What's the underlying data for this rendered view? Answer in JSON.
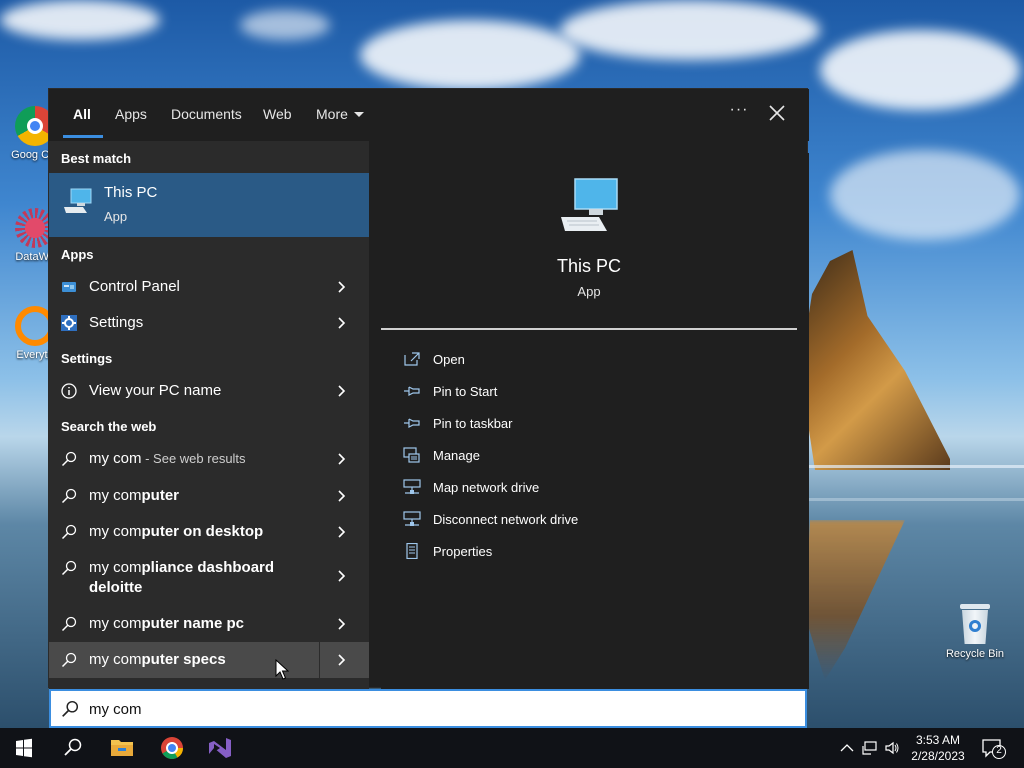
{
  "search_panel": {
    "tabs": [
      "All",
      "Apps",
      "Documents",
      "Web",
      "More"
    ],
    "options_label": "···",
    "best_match_header": "Best match",
    "best_match": {
      "title": "This PC",
      "subtitle": "App"
    },
    "apps_header": "Apps",
    "apps": [
      {
        "label": "Control Panel",
        "icon": "control-panel-icon"
      },
      {
        "label": "Settings",
        "icon": "gear-icon"
      }
    ],
    "settings_header": "Settings",
    "settings": [
      {
        "label": "View your PC name",
        "icon": "info-icon"
      }
    ],
    "web_header": "Search the web",
    "web_results": [
      {
        "prefix": "my com",
        "bold": "",
        "suffix": " - See web results"
      },
      {
        "prefix": "my com",
        "bold": "puter",
        "suffix": ""
      },
      {
        "prefix": "my com",
        "bold": "puter on desktop",
        "suffix": ""
      },
      {
        "prefix": "my com",
        "bold": "pliance dashboard",
        "line2": "deloitte",
        "suffix": ""
      },
      {
        "prefix": "my com",
        "bold": "puter name pc",
        "suffix": ""
      },
      {
        "prefix": "my com",
        "bold": "puter specs",
        "suffix": ""
      }
    ],
    "preview": {
      "title": "This PC",
      "subtitle": "App",
      "actions": [
        {
          "label": "Open",
          "icon": "open-icon"
        },
        {
          "label": "Pin to Start",
          "icon": "pin-icon"
        },
        {
          "label": "Pin to taskbar",
          "icon": "pin-icon"
        },
        {
          "label": "Manage",
          "icon": "manage-icon"
        },
        {
          "label": "Map network drive",
          "icon": "network-drive-icon"
        },
        {
          "label": "Disconnect network drive",
          "icon": "network-drive-icon"
        },
        {
          "label": "Properties",
          "icon": "properties-icon"
        }
      ]
    },
    "search_query": "my com"
  },
  "desktop": {
    "icons": [
      {
        "label": "Goog Chr",
        "icon": "chrome-icon"
      },
      {
        "label": "DataWa",
        "icon": "datawagon-icon"
      },
      {
        "label": "Everyth",
        "icon": "everything-icon"
      },
      {
        "label": "Recycle Bin",
        "icon": "recycle-bin-icon"
      }
    ]
  },
  "taskbar": {
    "time": "3:53 AM",
    "date": "2/28/2023",
    "notification_count": "2"
  },
  "colors": {
    "accent": "#3b8ee0",
    "best_match_bg": "#2a5a86",
    "panel_bg": "#1f1f1f",
    "results_bg": "#2b2b2b"
  }
}
